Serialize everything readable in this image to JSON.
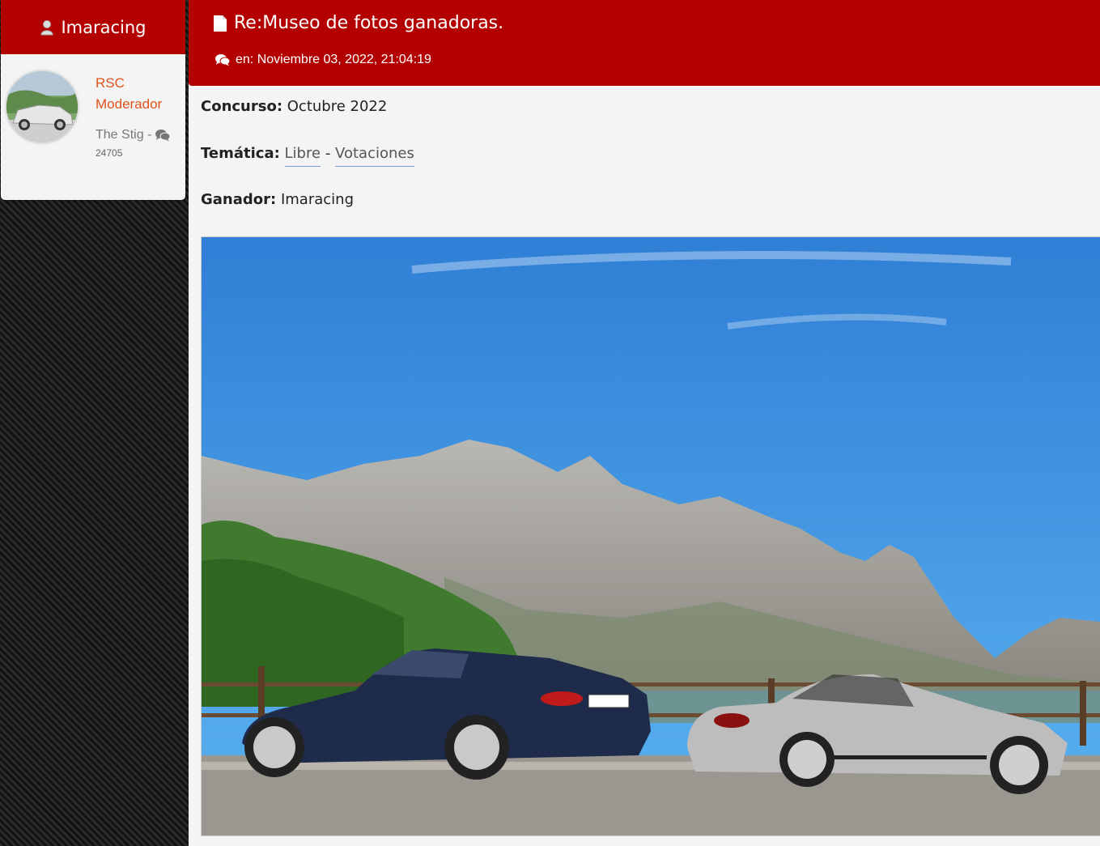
{
  "poster": {
    "username": "Imaracing",
    "rank_line1": "RSC",
    "rank_line2": "Moderador",
    "title": "The Stig -",
    "post_count": "24705"
  },
  "post": {
    "subject": "Re:Museo de fotos ganadoras.",
    "date": "en: Noviembre 03, 2022, 21:04:19",
    "concurso_label": "Concurso:",
    "concurso_value": "Octubre 2022",
    "tematica_label": "Temática:",
    "tematica_link1": "Libre",
    "tematica_sep": "-",
    "tematica_link2": "Votaciones",
    "ganador_label": "Ganador:",
    "ganador_value": "Imaracing"
  },
  "colors": {
    "header_red": "#b30000",
    "rank_orange": "#e0531a"
  },
  "icons": [
    "user-icon",
    "document-icon",
    "comments-icon"
  ]
}
